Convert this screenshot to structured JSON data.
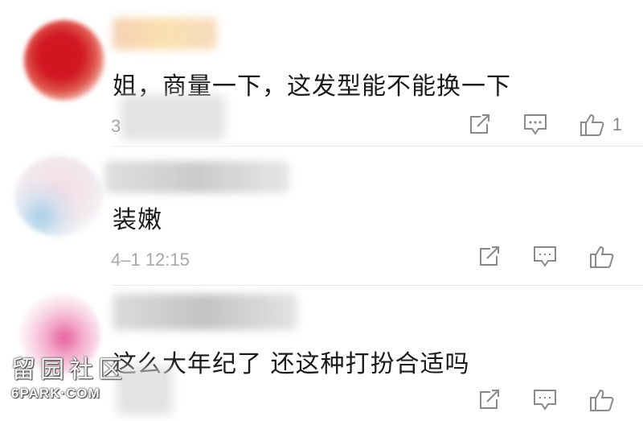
{
  "comments": [
    {
      "text": "姐，商量一下，这发型能不能换一下",
      "meta": "3",
      "like_count": "1"
    },
    {
      "text": "装嫩",
      "meta": "4–1 12:15",
      "like_count": ""
    },
    {
      "text": "这么大年纪了 还这种打扮合适吗",
      "meta": "",
      "like_count": ""
    }
  ],
  "icons": {
    "share": "share-icon",
    "reply": "reply-icon",
    "like": "like-icon"
  },
  "colors": {
    "text": "#1a1a1a",
    "meta": "#a8a8a8",
    "icon": "#8a8a8a"
  },
  "watermark": {
    "cn": "留园社区",
    "en": "6PARK·COM"
  }
}
